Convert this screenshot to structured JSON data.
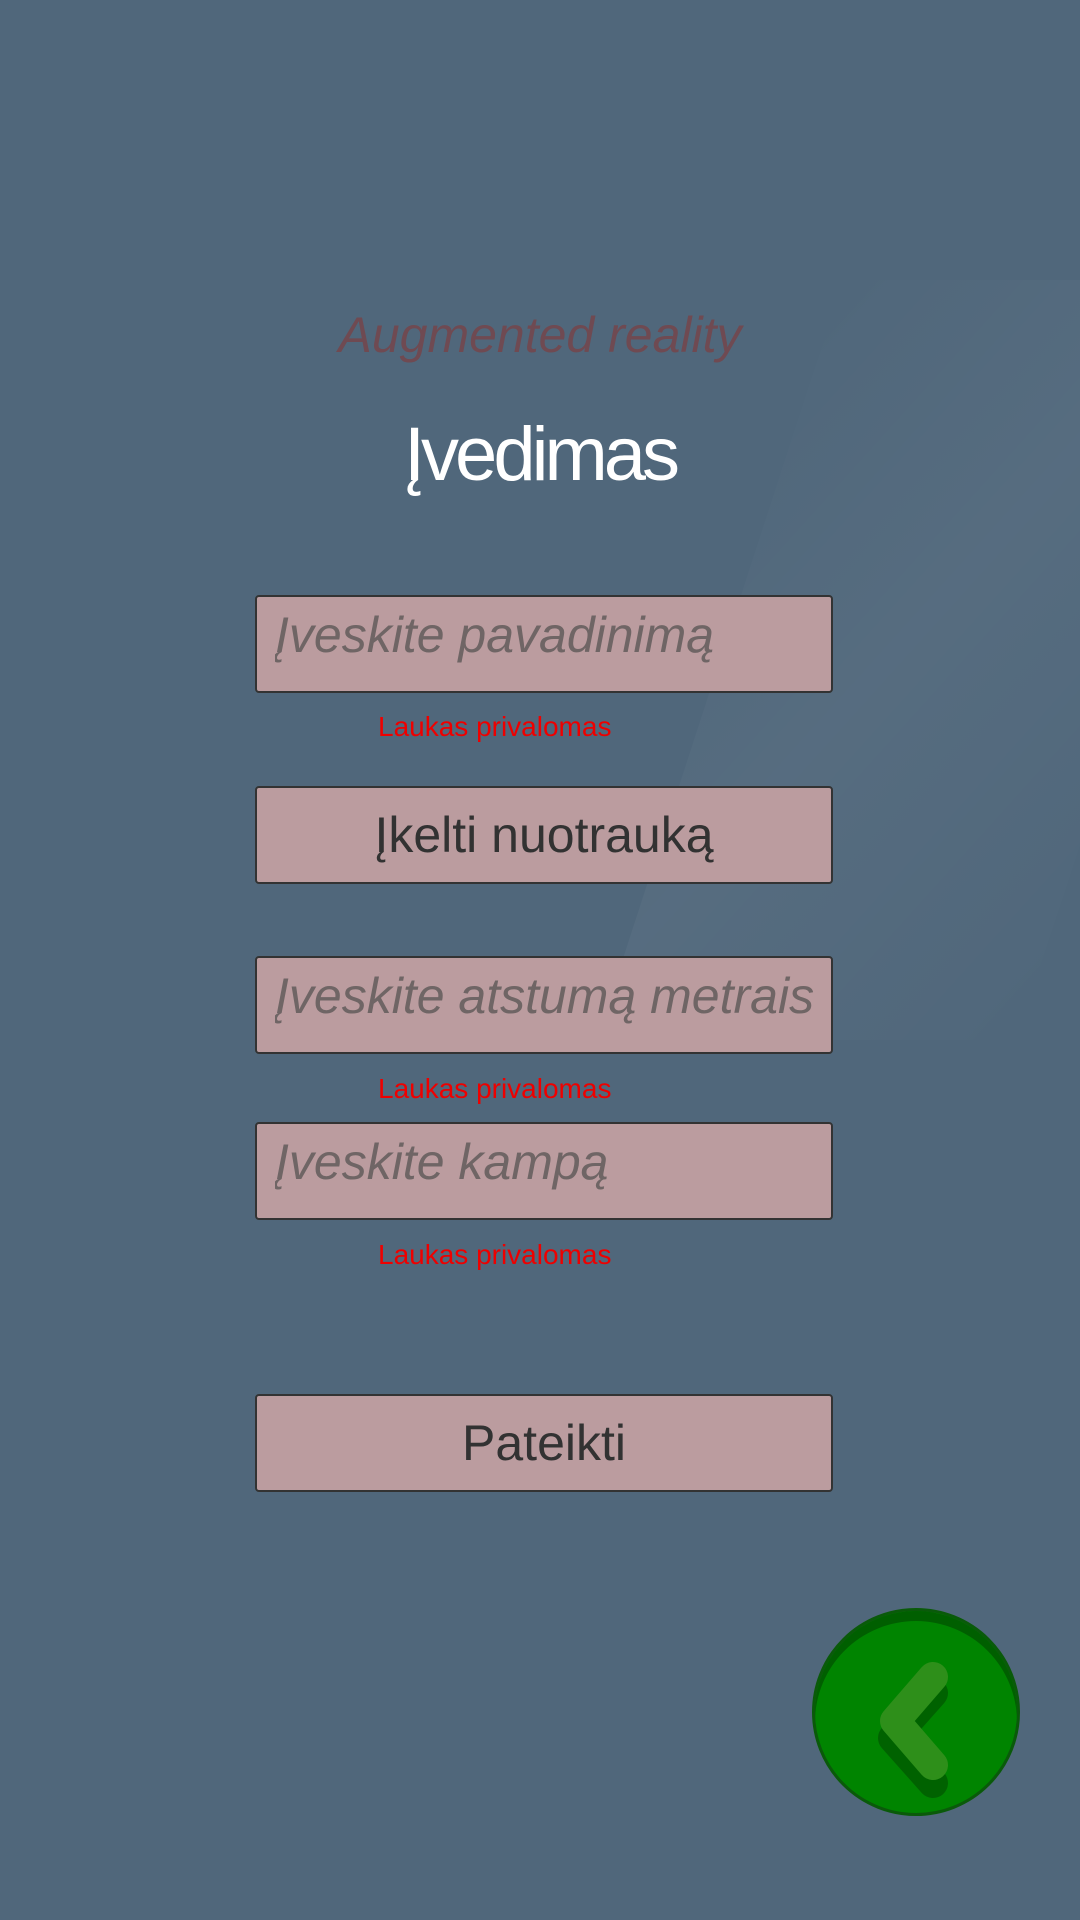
{
  "header": {
    "app_subtitle": "Augmented reality",
    "title": "Įvedimas"
  },
  "form": {
    "name_field": {
      "placeholder": "Įveskite pavadinimą",
      "value": "",
      "error": "Laukas privalomas"
    },
    "upload_button": {
      "label": "Įkelti nuotrauką"
    },
    "distance_field": {
      "placeholder": "Įveskite atstumą metrais",
      "value": "",
      "error": "Laukas privalomas"
    },
    "angle_field": {
      "placeholder": "Įveskite kampą",
      "value": "",
      "error": "Laukas privalomas"
    },
    "submit_button": {
      "label": "Pateikti"
    }
  },
  "back_button": {
    "icon": "chevron-left-icon"
  },
  "colors": {
    "background": "#50677b",
    "field_fill": "#bb9c9f",
    "error": "#ee0000",
    "back_button": "#008400"
  }
}
